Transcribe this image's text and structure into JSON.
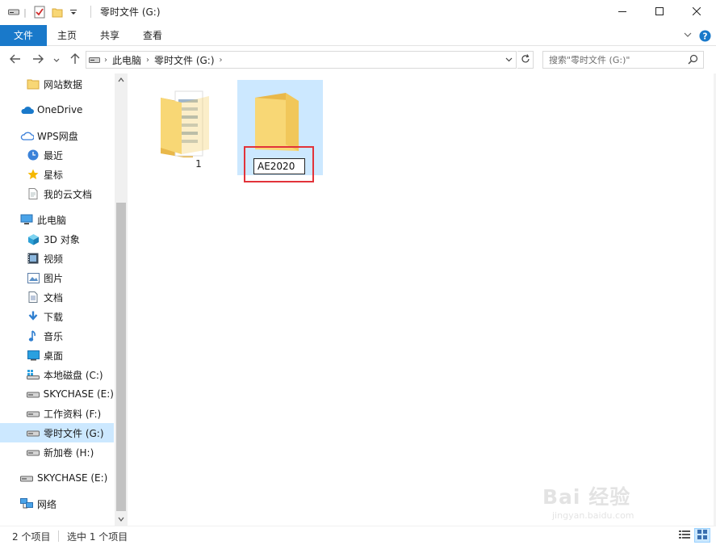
{
  "window": {
    "title": "零时文件 (G:)"
  },
  "ribbon": {
    "tabs": [
      "文件",
      "主页",
      "共享",
      "查看"
    ]
  },
  "address": {
    "crumbs": [
      "此电脑",
      "零时文件 (G:)"
    ],
    "search_placeholder": "搜索\"零时文件 (G:)\""
  },
  "nav": {
    "items": [
      {
        "label": "网站数据",
        "icon": "folder-icon"
      },
      {
        "label": "OneDrive",
        "icon": "onedrive-cloud-icon"
      },
      {
        "label": "WPS网盘",
        "icon": "wps-cloud-icon"
      },
      {
        "label": "最近",
        "icon": "clock-icon"
      },
      {
        "label": "星标",
        "icon": "star-icon"
      },
      {
        "label": "我的云文档",
        "icon": "document-icon"
      },
      {
        "label": "此电脑",
        "icon": "computer-icon"
      },
      {
        "label": "3D 对象",
        "icon": "cube-3d-icon"
      },
      {
        "label": "视频",
        "icon": "video-icon"
      },
      {
        "label": "图片",
        "icon": "picture-icon"
      },
      {
        "label": "文档",
        "icon": "documents-icon"
      },
      {
        "label": "下载",
        "icon": "download-icon"
      },
      {
        "label": "音乐",
        "icon": "music-icon"
      },
      {
        "label": "桌面",
        "icon": "desktop-icon"
      },
      {
        "label": "本地磁盘 (C:)",
        "icon": "windows-drive-icon"
      },
      {
        "label": "SKYCHASE (E:)",
        "icon": "drive-icon"
      },
      {
        "label": "工作资料 (F:)",
        "icon": "drive-icon"
      },
      {
        "label": "零时文件 (G:)",
        "icon": "drive-icon",
        "selected": true
      },
      {
        "label": "新加卷 (H:)",
        "icon": "drive-icon"
      },
      {
        "label": "SKYCHASE (E:)",
        "icon": "drive-icon"
      },
      {
        "label": "网络",
        "icon": "network-icon"
      }
    ]
  },
  "files": [
    {
      "name": "1",
      "type": "folder-with-documents"
    },
    {
      "name": "AE2020",
      "type": "folder",
      "selected": true,
      "renaming": true
    }
  ],
  "status": {
    "item_count": "2 个项目",
    "selection": "选中 1 个项目"
  },
  "watermark": {
    "main": "Bai 经验",
    "sub": "jingyan.baidu.com"
  },
  "colors": {
    "accent": "#1979ca",
    "selection": "#cce8ff",
    "highlight": "#e2333a",
    "folder": "#f8d775"
  }
}
